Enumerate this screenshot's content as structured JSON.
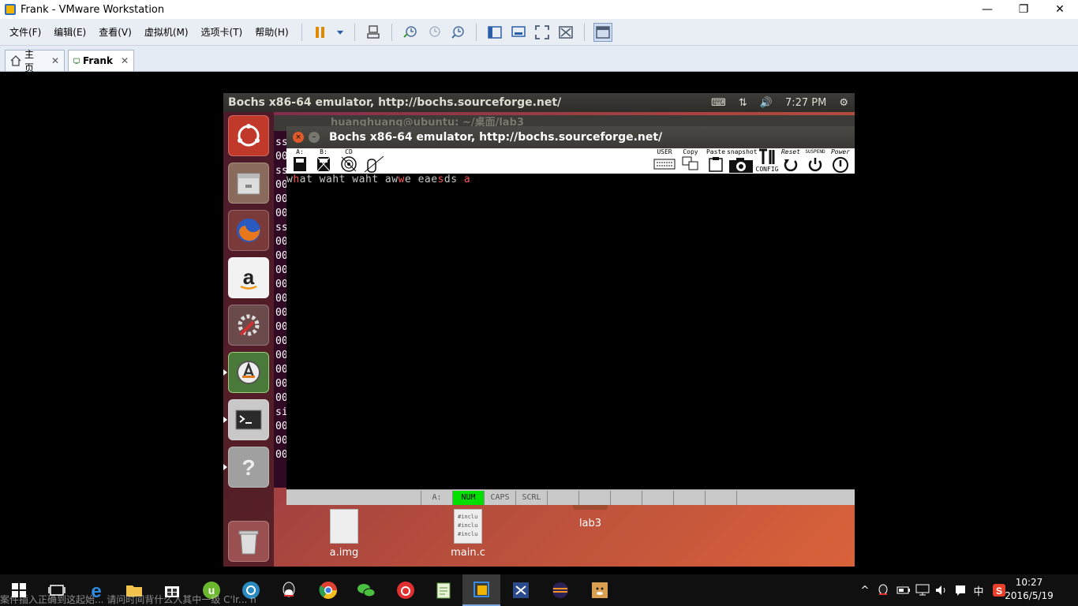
{
  "window": {
    "title": "Frank - VMware Workstation",
    "minimize": "—",
    "maximize": "❐",
    "close": "✕"
  },
  "menu": {
    "items": [
      "文件(F)",
      "编辑(E)",
      "查看(V)",
      "虚拟机(M)",
      "选项卡(T)",
      "帮助(H)"
    ]
  },
  "tabs": [
    {
      "label": "主页",
      "close": "✕"
    },
    {
      "label": "Frank",
      "close": "✕"
    }
  ],
  "ubuntu": {
    "topbar": {
      "title": "Bochs x86-64 emulator, http://bochs.sourceforge.net/",
      "time": "7:27 PM"
    },
    "terminal": {
      "title": "huanghuang@ubuntu: ~/桌面/lab3",
      "lines": [
        "ss",
        "00",
        "ss",
        "00",
        "00",
        "00",
        "ss",
        "00",
        "00",
        "00",
        "00",
        "00",
        "00",
        "00",
        "00",
        "00",
        "00",
        "00",
        "00",
        "si",
        "00",
        "00",
        "00"
      ]
    },
    "bochs": {
      "title": "Bochs x86-64 emulator, http://bochs.sourceforge.net/",
      "toolbar": {
        "a": "A:",
        "b": "B:",
        "cd": "CD",
        "user": "USER",
        "copy": "Copy",
        "paste": "Paste",
        "snapshot": "snapshot",
        "config": "CONFIG",
        "reset": "Reset",
        "suspend": "SUSPEND",
        "power": "Power"
      },
      "screen_text": "what waht waht awwe eaesds a",
      "status": {
        "drive": "A:",
        "num": "NUM",
        "caps": "CAPS",
        "scrl": "SCRL"
      },
      "colors": {
        "num_on": "#00e000",
        "highlight": "#ff5555"
      }
    },
    "desktop_icons": [
      {
        "label": "a.img"
      },
      {
        "label": "main.c",
        "preview": [
          "#inclu",
          "#inclu",
          "#inclu"
        ]
      },
      {
        "label": "lab3"
      }
    ]
  },
  "taskbar": {
    "clock_time": "10:27",
    "clock_date": "2016/5/19",
    "ime": "中",
    "ime_hint": "案件插入正确到这起始... 请问时间背什么入其中一级 C'lr... n"
  }
}
